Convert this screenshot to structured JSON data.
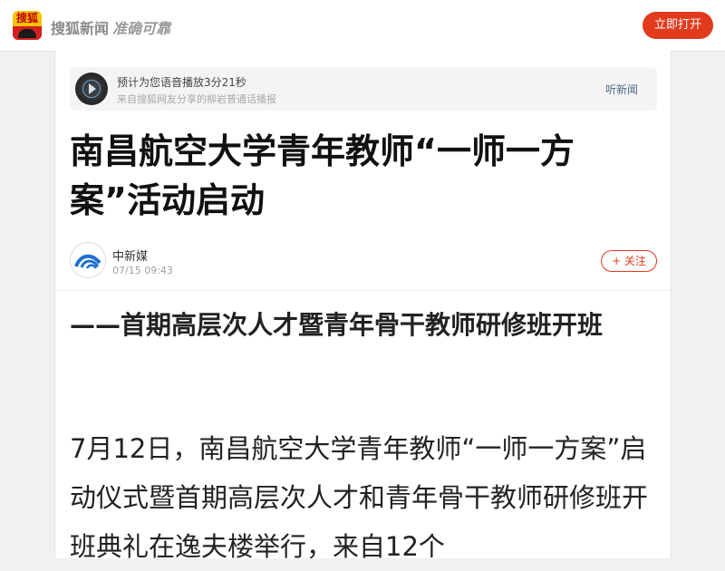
{
  "header": {
    "logo_text": "搜狐",
    "brand": "搜狐新闻",
    "slogan": "准确可靠",
    "open_button": "立即打开"
  },
  "audio": {
    "title": "预计为您语音播放3分21秒",
    "subtitle": "来自搜狐网友分享的柳岩普通话播报",
    "listen_link": "听新闻"
  },
  "article": {
    "headline": "南昌航空大学青年教师“一师一方案”活动启动",
    "author": {
      "name": "中新媒",
      "time": "07/15 09:43",
      "follow_label": "+ 关注"
    },
    "subtitle": "——首期高层次人才暨青年骨干教师研修班开班",
    "paragraph": "7月12日，南昌航空大学青年教师“一师一方案”启动仪式暨首期高层次人才和青年骨干教师研修班开班典礼在逸夫楼举行，来自12个"
  },
  "colors": {
    "accent": "#e23a1d",
    "link": "#4f6a8f",
    "logo_yellow": "#f5c400",
    "avatar_blue": "#1f6fd1"
  }
}
